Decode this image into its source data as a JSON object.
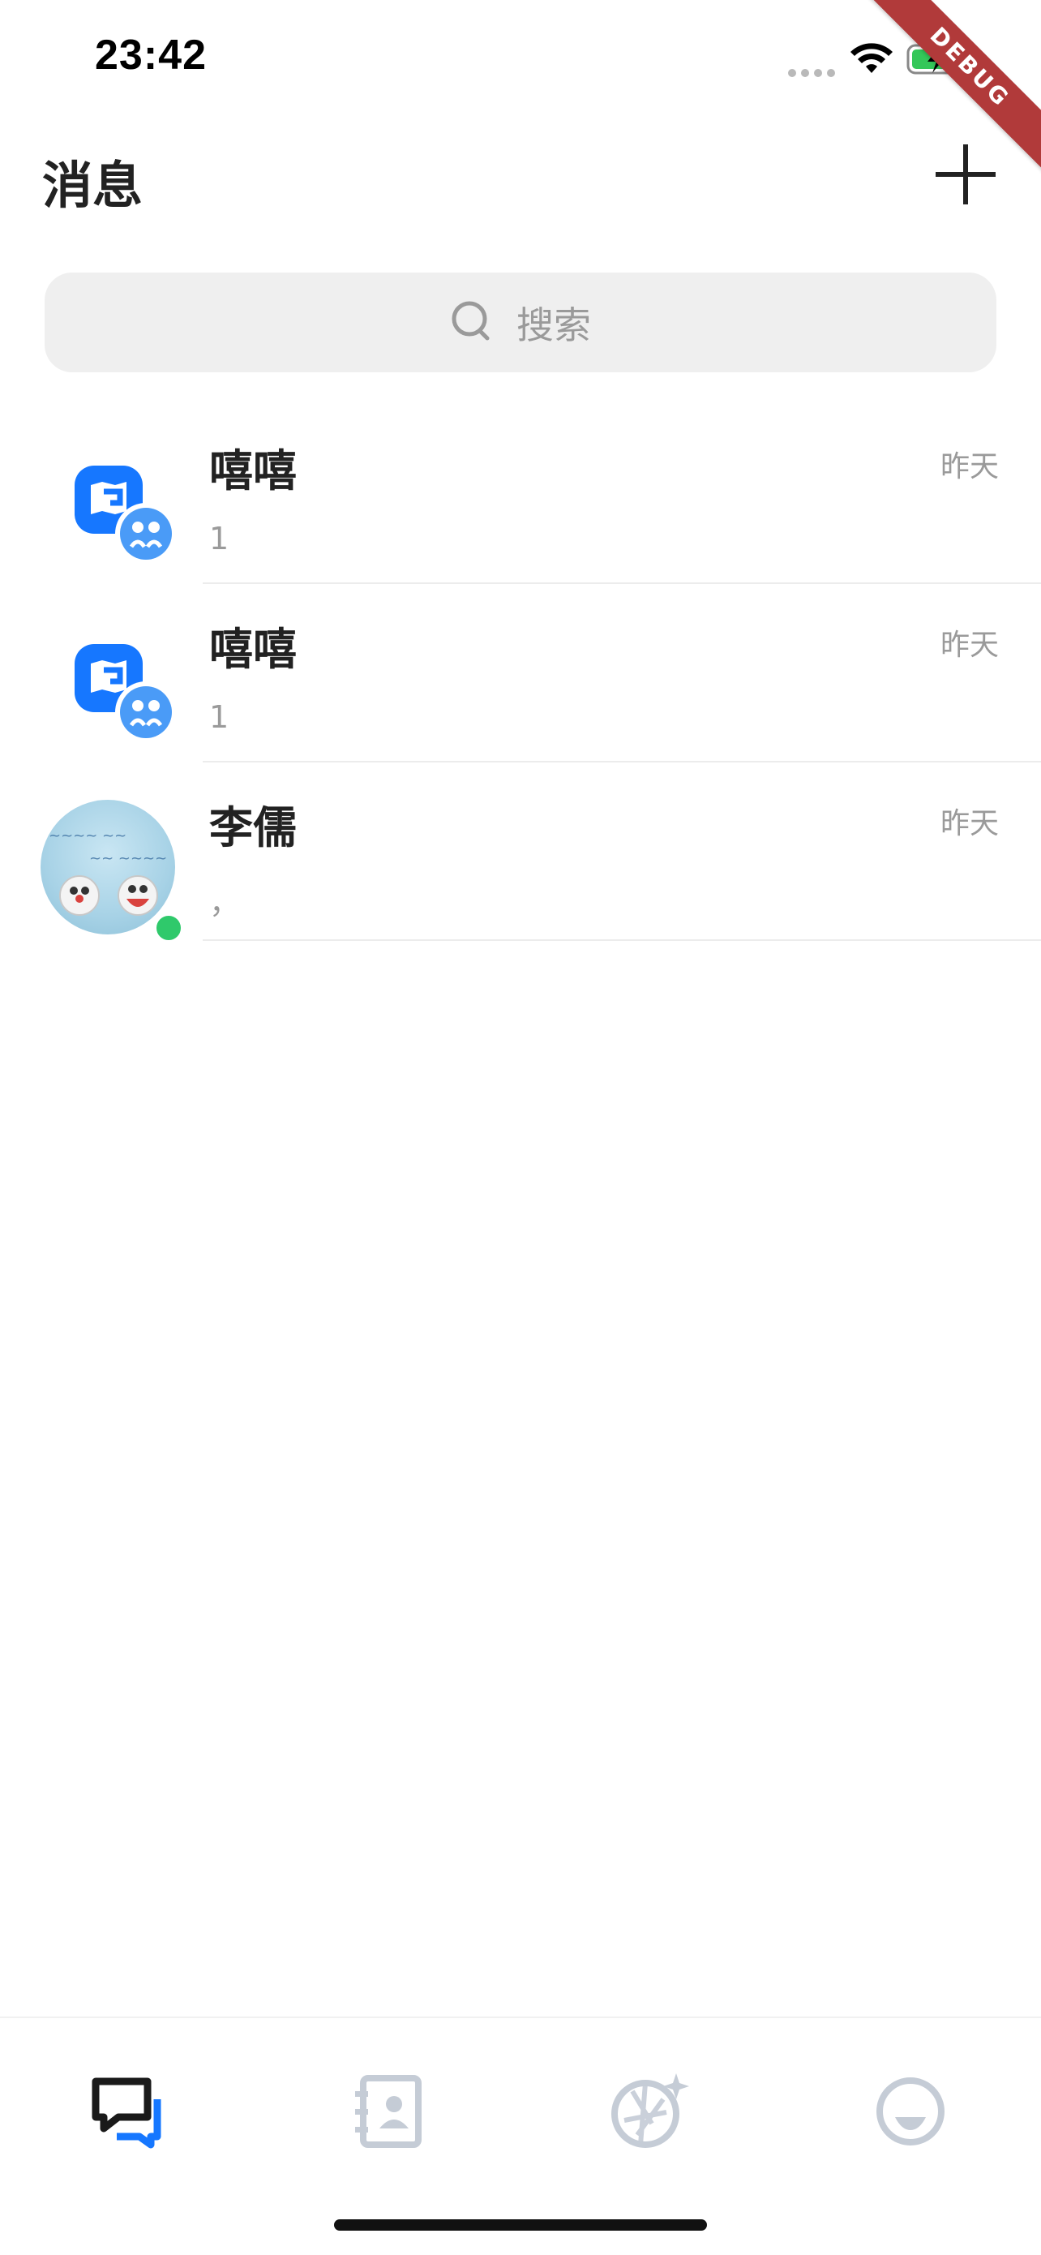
{
  "status_bar": {
    "time": "23:42",
    "debug_label": "DEBUG",
    "battery_color": "#34c759",
    "icons": [
      "cellular-dots-icon",
      "wifi-icon",
      "battery-charging-icon"
    ]
  },
  "header": {
    "title": "消息",
    "add_icon": "plus-icon"
  },
  "search": {
    "placeholder": "搜索",
    "icon": "search-icon"
  },
  "conversations": [
    {
      "name": "嘻嘻",
      "time": "昨天",
      "preview": "1",
      "avatar": "group-chat-avatar",
      "online": false
    },
    {
      "name": "嘻嘻",
      "time": "昨天",
      "preview": "1",
      "avatar": "group-chat-avatar",
      "online": false
    },
    {
      "name": "李儒",
      "time": "昨天",
      "preview": "，",
      "avatar": "doraemon-photo-avatar",
      "online": true
    }
  ],
  "tab_bar": {
    "tabs": [
      {
        "name": "messages",
        "icon": "chat-bubbles-icon",
        "active": true
      },
      {
        "name": "contacts",
        "icon": "contact-book-icon",
        "active": false
      },
      {
        "name": "moments",
        "icon": "camera-aperture-sparkle-icon",
        "active": false
      },
      {
        "name": "profile",
        "icon": "smiley-face-icon",
        "active": false
      }
    ],
    "active_color": "#1a1a1a",
    "accent_color": "#1677ff",
    "inactive_color": "#c5ccd6"
  }
}
